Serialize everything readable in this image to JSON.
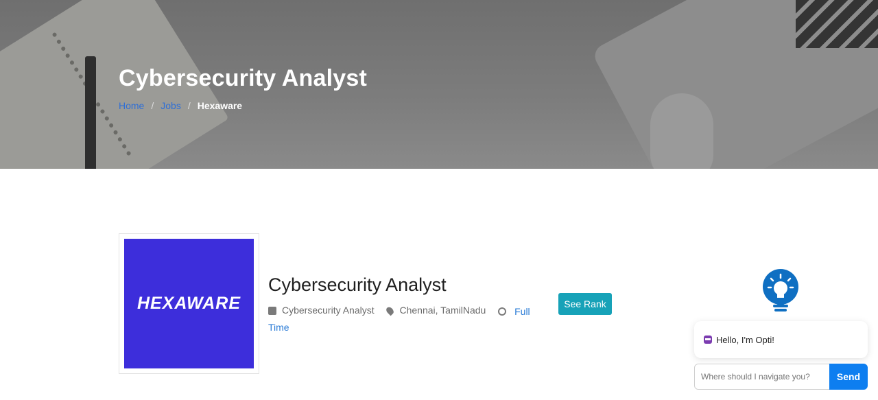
{
  "hero": {
    "title": "Cybersecurity Analyst",
    "breadcrumb": {
      "home": "Home",
      "jobs": "Jobs",
      "current": "Hexaware",
      "separator": "/"
    }
  },
  "company": {
    "logo_text": "HEXAWARE",
    "logo_bg": "#3d2edb"
  },
  "job": {
    "title": "Cybersecurity Analyst",
    "role": "Cybersecurity Analyst",
    "location": "Chennai, TamilNadu",
    "type": "Full Time"
  },
  "actions": {
    "see_rank": "See Rank"
  },
  "chat": {
    "greeting": "Hello, I'm Opti!",
    "placeholder": "Where should I navigate you?",
    "send_label": "Send"
  },
  "colors": {
    "accent": "#17a2b8",
    "send": "#0d7ef0",
    "link": "#2a7bd6"
  }
}
